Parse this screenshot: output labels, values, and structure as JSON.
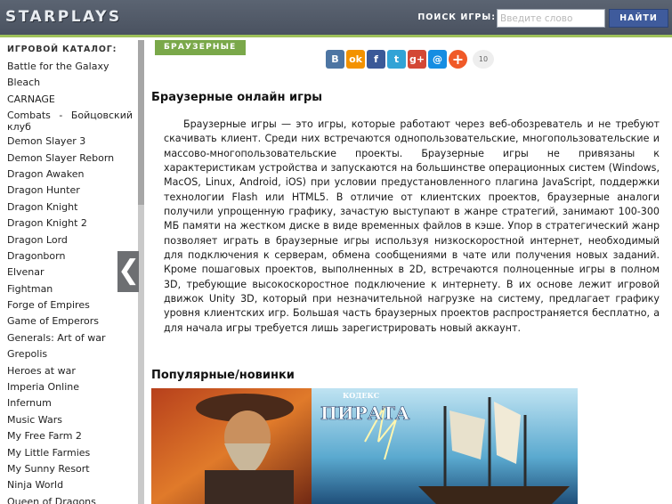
{
  "header": {
    "logo": "STARPLAYS",
    "search_label": "ПОИСК ИГРЫ:",
    "search_placeholder": "Введите слово",
    "search_button": "НАЙТИ"
  },
  "sidebar": {
    "title": "ИГРОВОЙ КАТАЛОГ:",
    "items": [
      "Battle for the Galaxy",
      "Bleach",
      "CARNAGE",
      "Combats - Бойцовский клуб",
      "Demon Slayer 3",
      "Demon Slayer Reborn",
      "Dragon Awaken",
      "Dragon Hunter",
      "Dragon Knight",
      "Dragon Knight 2",
      "Dragon Lord",
      "Dragonborn",
      "Elvenar",
      "Fightman",
      "Forge of Empires",
      "Game of Emperors",
      "Generals: Art of war",
      "Grepolis",
      "Heroes at war",
      "Imperia Online",
      "Infernum",
      "Music Wars",
      "My Free Farm 2",
      "My Little Farmies",
      "My Sunny Resort",
      "Ninja World",
      "Queen of Dragons"
    ],
    "collapse_glyph": "❮"
  },
  "main": {
    "category_tag": "БРАУЗЕРНЫЕ",
    "share": {
      "vk": "В",
      "ok": "ok",
      "fb": "f",
      "tw": "t",
      "gp": "g+",
      "ml": "@",
      "plus": "+",
      "count": "10"
    },
    "title": "Браузерные онлайн игры",
    "article": "Браузерные игры — это игры, которые работают через веб-обозреватель и не требуют скачивать клиент. Среди них встречаются однопользовательские, многопользовательские и массово-многопользовательские проекты. Браузерные игры не привязаны к характеристикам устройства и запускаются на большинстве операционных систем (Windows, MacOS, Linux, Android, iOS) при условии предустановленного плагина JavaScript, поддержки технологии Flash или HTML5. В отличие от клиентских проектов, браузерные аналоги получили упрощенную графику, зачастую выступают в жанре стратегий, занимают 100-300 МБ памяти на жестком диске в виде временных файлов в кэше. Упор в стратегический жанр позволяет играть в браузерные игры используя низкоскоростной интернет, необходимый для подключения к серверам, обмена сообщениями в чате или получения новых заданий. Кроме пошаговых проектов, выполненных в 2D, встречаются полноценные игры в полном 3D, требующие высокоскоростное подключение к интернету. В их основе лежит игровой движок Unity 3D, который при незначительной нагрузке на систему, предлагает графику уровня клиентских игр. Большая часть браузерных проектов распространяется бесплатно, а для начала игры требуется лишь зарегистрировать новый аккаунт.",
    "popular_heading": "Популярные/новинки",
    "banner": {
      "logo_small": "КОДЕКС",
      "logo_big": "ПИРАТА"
    }
  }
}
